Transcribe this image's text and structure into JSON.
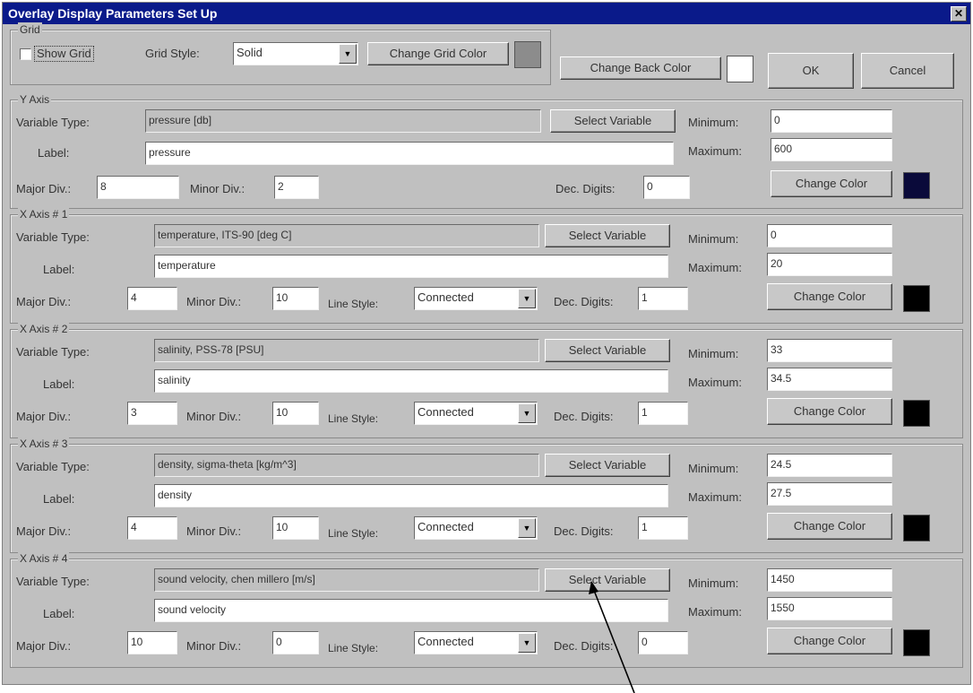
{
  "window": {
    "title": "Overlay Display Parameters Set Up",
    "close_glyph": "✕"
  },
  "grid": {
    "legend": "Grid",
    "show_grid_label": "Show Grid",
    "show_grid_checked": false,
    "style_label": "Grid Style:",
    "style_value": "Solid",
    "change_grid_color": "Change Grid Color",
    "grid_color": "#8c8c8c",
    "change_back_color": "Change Back Color",
    "back_color": "#ffffff"
  },
  "buttons": {
    "ok": "OK",
    "cancel": "Cancel"
  },
  "labels": {
    "variable_type": "Variable Type:",
    "label": "Label:",
    "major_div": "Major Div.:",
    "minor_div": "Minor Div.:",
    "line_style": "Line Style:",
    "dec_digits": "Dec. Digits:",
    "minimum": "Minimum:",
    "maximum": "Maximum:",
    "select_variable": "Select Variable",
    "change_color": "Change Color"
  },
  "y_axis": {
    "legend": "Y Axis",
    "variable_type": "pressure [db]",
    "label": "pressure",
    "major_div": "8",
    "minor_div": "2",
    "dec_digits": "0",
    "minimum": "0",
    "maximum": "600",
    "color": "#0a0a3a"
  },
  "x_axes": [
    {
      "legend": "X Axis # 1",
      "variable_type": "temperature, ITS-90 [deg C]",
      "label": "temperature",
      "major_div": "4",
      "minor_div": "10",
      "line_style": "Connected",
      "dec_digits": "1",
      "minimum": "0",
      "maximum": "20",
      "color": "#000000"
    },
    {
      "legend": "X Axis # 2",
      "variable_type": "salinity, PSS-78 [PSU]",
      "label": "salinity",
      "major_div": "3",
      "minor_div": "10",
      "line_style": "Connected",
      "dec_digits": "1",
      "minimum": "33",
      "maximum": "34.5",
      "color": "#000000"
    },
    {
      "legend": "X Axis # 3",
      "variable_type": "density, sigma-theta [kg/m^3]",
      "label": "density",
      "major_div": "4",
      "minor_div": "10",
      "line_style": "Connected",
      "dec_digits": "1",
      "minimum": "24.5",
      "maximum": "27.5",
      "color": "#000000"
    },
    {
      "legend": "X Axis # 4",
      "variable_type": "sound velocity, chen millero [m/s]",
      "label": "sound velocity",
      "major_div": "10",
      "minor_div": "0",
      "line_style": "Connected",
      "dec_digits": "0",
      "minimum": "1450",
      "maximum": "1550",
      "color": "#000000"
    }
  ]
}
